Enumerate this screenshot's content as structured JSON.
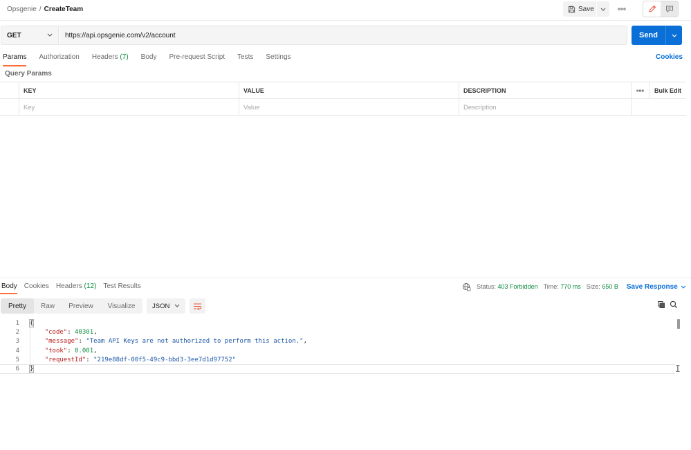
{
  "breadcrumb": {
    "workspace": "Opsgenie",
    "separator": "/",
    "request_name": "CreateTeam"
  },
  "toolbar": {
    "save_label": "Save"
  },
  "request": {
    "method": "GET",
    "url": "https://api.opsgenie.com/v2/account",
    "send_label": "Send",
    "tabs": [
      {
        "label": "Params",
        "count": ""
      },
      {
        "label": "Authorization",
        "count": ""
      },
      {
        "label": "Headers",
        "count": "(7)"
      },
      {
        "label": "Body",
        "count": ""
      },
      {
        "label": "Pre-request Script",
        "count": ""
      },
      {
        "label": "Tests",
        "count": ""
      },
      {
        "label": "Settings",
        "count": ""
      }
    ],
    "cookies_label": "Cookies",
    "section_title": "Query Params",
    "table": {
      "headers": {
        "key": "KEY",
        "value": "VALUE",
        "description": "DESCRIPTION",
        "bulk_edit": "Bulk Edit"
      },
      "placeholders": {
        "key": "Key",
        "value": "Value",
        "description": "Description"
      }
    }
  },
  "response": {
    "tabs": [
      {
        "label": "Body",
        "count": ""
      },
      {
        "label": "Cookies",
        "count": ""
      },
      {
        "label": "Headers",
        "count": "(12)"
      },
      {
        "label": "Test Results",
        "count": ""
      }
    ],
    "status_label": "Status:",
    "status_value": "403 Forbidden",
    "time_label": "Time:",
    "time_value": "770 ms",
    "size_label": "Size:",
    "size_value": "650 B",
    "save_response_label": "Save Response",
    "view_modes": [
      "Pretty",
      "Raw",
      "Preview",
      "Visualize"
    ],
    "language": "JSON",
    "body_lines": {
      "open": "{",
      "code_key": "\"code\"",
      "code_value": "40301",
      "message_key": "\"message\"",
      "message_value": "\"Team API Keys are not authorized to perform this action.\"",
      "took_key": "\"took\"",
      "took_value": "0.001",
      "request_id_key": "\"requestId\"",
      "request_id_value": "\"219e88df-00f5-49c9-bbd3-3ee7d1d97752\"",
      "close": "}"
    },
    "line_numbers": [
      "1",
      "2",
      "3",
      "4",
      "5",
      "6"
    ]
  },
  "colors": {
    "accent": "#ff6c37",
    "primary": "#0a6fd6",
    "success": "#0e8a3e"
  }
}
